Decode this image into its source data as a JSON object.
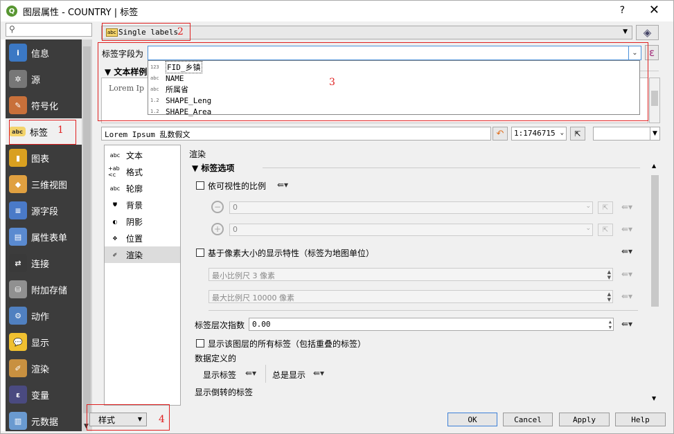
{
  "window": {
    "title": "图层属性 - COUNTRY | 标签",
    "help_glyph": "?",
    "close_glyph": "✕",
    "app_icon": "Q"
  },
  "search": {
    "placeholder": ""
  },
  "sidebar": {
    "items": [
      {
        "label": "信息",
        "icon": "info-icon",
        "color": "#3b78c4",
        "glyph": "i"
      },
      {
        "label": "源",
        "icon": "wrench-icon",
        "color": "#777777",
        "glyph": "✲"
      },
      {
        "label": "符号化",
        "icon": "paintbrush-icon",
        "color": "#c8703a",
        "glyph": "✎"
      },
      {
        "label": "标签",
        "icon": "abc-label-icon",
        "color": "#f4d46b",
        "glyph": "abc"
      },
      {
        "label": "图表",
        "icon": "diagram-icon",
        "color": "#d9a020",
        "glyph": "▮"
      },
      {
        "label": "三维视图",
        "icon": "cube-3d-icon",
        "color": "#e0a040",
        "glyph": "◆"
      },
      {
        "label": "源字段",
        "icon": "fields-icon",
        "color": "#4a7ac8",
        "glyph": "≡"
      },
      {
        "label": "属性表单",
        "icon": "form-icon",
        "color": "#5a8ad0",
        "glyph": "▤"
      },
      {
        "label": "连接",
        "icon": "join-icon",
        "color": "#3a3a3a",
        "glyph": "⇄"
      },
      {
        "label": "附加存储",
        "icon": "database-icon",
        "color": "#909090",
        "glyph": "⛁"
      },
      {
        "label": "动作",
        "icon": "action-gear-icon",
        "color": "#5080c0",
        "glyph": "⚙"
      },
      {
        "label": "显示",
        "icon": "speech-bubble-icon",
        "color": "#f0c030",
        "glyph": "💬"
      },
      {
        "label": "渲染",
        "icon": "brush-icon",
        "color": "#c89040",
        "glyph": "✐"
      },
      {
        "label": "变量",
        "icon": "epsilon-icon",
        "color": "#4a4a80",
        "glyph": "ε"
      },
      {
        "label": "元数据",
        "icon": "metadata-icon",
        "color": "#6a9ad0",
        "glyph": "▥"
      }
    ]
  },
  "labels": {
    "mode": "Single labels",
    "mode_abc": "abc",
    "field_label": "标签字段为",
    "field_value": "",
    "expr_glyph": "ε",
    "fields": [
      {
        "type": "123",
        "name": "FID_乡镇"
      },
      {
        "type": "abc",
        "name": "NAME"
      },
      {
        "type": "abc",
        "name": "所属省"
      },
      {
        "type": "1.2",
        "name": "SHAPE_Leng"
      },
      {
        "type": "1.2",
        "name": "SHAPE_Area"
      }
    ],
    "text_sample_header": "文本样例",
    "preview_text": "Lorem Ip",
    "sample_input": "Lorem Ipsum 乱数假文",
    "scale": "1:1746715"
  },
  "tabs": [
    {
      "label": "文本",
      "icon": "text-abc-icon",
      "glyph": "abc"
    },
    {
      "label": "格式",
      "icon": "format-icon",
      "glyph": "+ab\n<c"
    },
    {
      "label": "轮廓",
      "icon": "buffer-icon",
      "glyph": "abc"
    },
    {
      "label": "背景",
      "icon": "background-shield-icon",
      "glyph": "⛊"
    },
    {
      "label": "阴影",
      "icon": "shadow-icon",
      "glyph": "◐"
    },
    {
      "label": "位置",
      "icon": "placement-icon",
      "glyph": "✥"
    },
    {
      "label": "渲染",
      "icon": "rendering-brush-icon",
      "glyph": "✐"
    }
  ],
  "rendering": {
    "title": "渲染",
    "label_options": "标签选项",
    "scale_visibility": "依可视性的比例",
    "min_scale_value": "0",
    "max_scale_value": "0",
    "pixel_size": "基于像素大小的显示特性（标签为地图单位）",
    "min_pixel": "最小比例尺 3 像素",
    "max_pixel": "最大比例尺 10000 像素",
    "z_index_label": "标签层次指数",
    "z_index": "0.00",
    "show_all": "显示该图层的所有标签（包括重叠的标签）",
    "data_defined": "数据定义的",
    "show_label": "显示标签",
    "always_show": "总是显示",
    "upside_down": "显示倒转的标签"
  },
  "buttons": {
    "style": "样式",
    "ok": "OK",
    "cancel": "Cancel",
    "apply": "Apply",
    "help": "Help"
  },
  "annotations": [
    "1",
    "2",
    "3",
    "4"
  ]
}
